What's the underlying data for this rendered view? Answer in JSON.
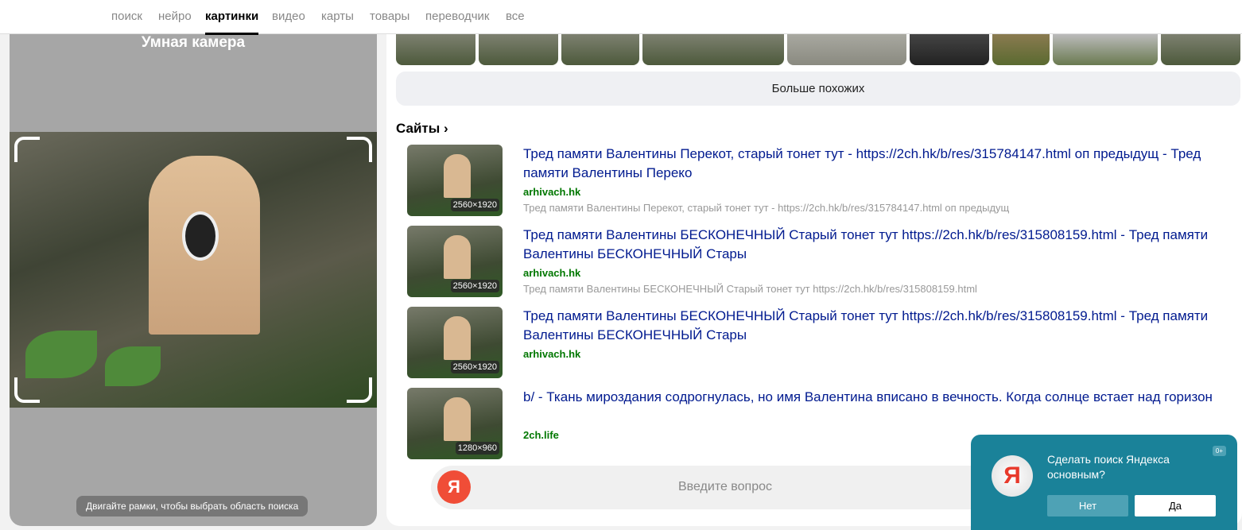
{
  "nav": {
    "items": [
      "поиск",
      "нейро",
      "картинки",
      "видео",
      "карты",
      "товары",
      "переводчик",
      "все"
    ],
    "active": "картинки"
  },
  "camera": {
    "title": "Умная камера",
    "hint": "Двигайте рамки, чтобы выбрать область поиска"
  },
  "more_similar": "Больше похожих",
  "sites_heading": "Сайты",
  "results": [
    {
      "title": "Тред памяти Валентины Перекот, старый тонет тут - https://2ch.hk/b/res/315784147.html оп предыдущ - Тред памяти Валентины Переко",
      "host": "arhivach.hk",
      "desc": "Тред памяти Валентины Перекот, старый тонет тут - https://2ch.hk/b/res/315784147.html оп предыдущ",
      "size": "2560×1920"
    },
    {
      "title": "Тред памяти Валентины БЕСКОНЕЧНЫЙ Старый тонет тут https://2ch.hk/b/res/315808159.html - Тред памяти Валентины БЕСКОНЕЧНЫЙ Стары",
      "host": "arhivach.hk",
      "desc": "Тред памяти Валентины БЕСКОНЕЧНЫЙ Старый тонет тут https://2ch.hk/b/res/315808159.html",
      "size": "2560×1920"
    },
    {
      "title": "Тред памяти Валентины БЕСКОНЕЧНЫЙ Старый тонет тут https://2ch.hk/b/res/315808159.html - Тред памяти Валентины БЕСКОНЕЧНЫЙ Стары",
      "host": "arhivach.hk",
      "desc": "",
      "size": "2560×1920"
    },
    {
      "title": "b/ - Ткань мироздания содрогнулась, но имя Валентина вписано в вечность. Когда солнце встает над горизон",
      "host": "2ch.life",
      "desc": "",
      "size": "1280×960"
    }
  ],
  "search": {
    "placeholder": "Введите вопрос",
    "logo": "Я"
  },
  "popup": {
    "text": "Сделать поиск Яндекса основным?",
    "age": "0+",
    "no": "Нет",
    "yes": "Да",
    "logo": "Я"
  }
}
